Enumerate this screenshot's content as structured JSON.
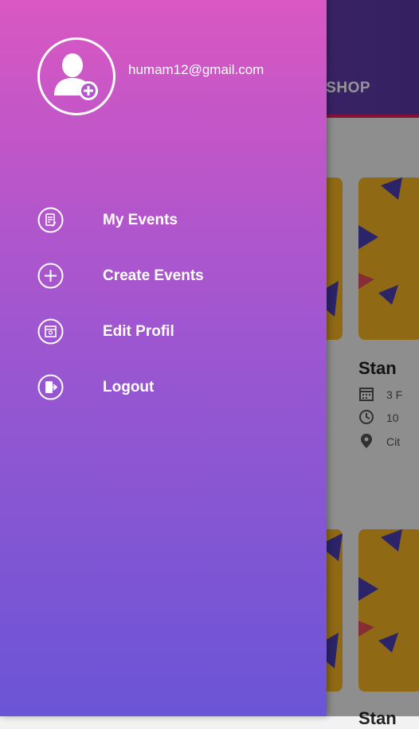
{
  "app": {
    "tab_label": "KSHOP",
    "cards": [
      {
        "title": "Stan",
        "date": "3 F",
        "time": "10",
        "location": "Cit"
      },
      {
        "title": "Stan"
      }
    ]
  },
  "drawer": {
    "email": "humam12@gmail.com",
    "menu": [
      {
        "label": "My Events",
        "icon": "my-events-icon"
      },
      {
        "label": "Create Events",
        "icon": "plus-icon"
      },
      {
        "label": "Edit Profil",
        "icon": "edit-profile-icon"
      },
      {
        "label": "Logout",
        "icon": "logout-icon"
      }
    ]
  },
  "colors": {
    "drawer_top": "#d957c2",
    "drawer_bottom": "#6a55d6",
    "appbar": "#6a3db6",
    "tab_indicator": "#e91e63",
    "card_accent": "#f7b523"
  }
}
